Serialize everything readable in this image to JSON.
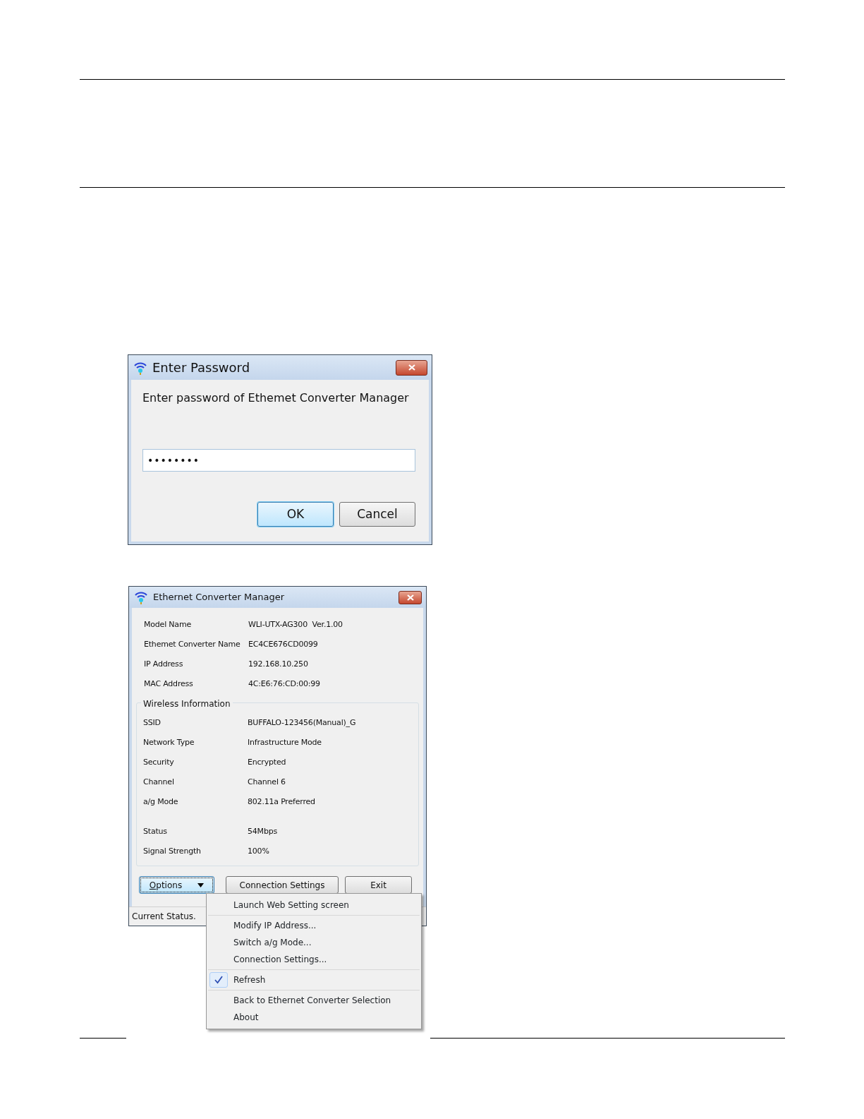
{
  "password_dialog": {
    "title": "Enter Password",
    "prompt": "Enter password of Ethemet Converter Manager",
    "password_field": {
      "value": "••••••••"
    },
    "buttons": [
      {
        "label": "OK",
        "default": true
      },
      {
        "label": "Cancel",
        "default": false
      }
    ]
  },
  "manager_window": {
    "title": "Ethernet Converter Manager",
    "info": [
      {
        "label": "Model Name",
        "value": "WLI-UTX-AG300  Ver.1.00"
      },
      {
        "label": "Ethemet Converter Name",
        "value": "EC4CE676CD0099"
      },
      {
        "label": "IP Address",
        "value": "192.168.10.250"
      },
      {
        "label": "MAC Address",
        "value": "4C:E6:76:CD:00:99"
      }
    ],
    "wireless_group": {
      "title": "Wireless Information",
      "rows": [
        {
          "label": "SSID",
          "value": "BUFFALO-123456(Manual)_G"
        },
        {
          "label": "Network Type",
          "value": "Infrastructure Mode"
        },
        {
          "label": "Security",
          "value": "Encrypted"
        },
        {
          "label": "Channel",
          "value": "Channel 6"
        },
        {
          "label": "a/g Mode",
          "value": "802.11a Preferred"
        }
      ],
      "status_rows": [
        {
          "label": "Status",
          "value": "54Mbps"
        },
        {
          "label": "Signal Strength",
          "value": "100%"
        }
      ]
    },
    "buttons": [
      {
        "label": "Options",
        "focused": true,
        "dropdown": true
      },
      {
        "label": "Connection Settings",
        "focused": false,
        "dropdown": false
      },
      {
        "label": "Exit",
        "focused": false,
        "dropdown": false
      }
    ],
    "status_bar": "Current Status."
  },
  "options_menu": {
    "groups": [
      [
        {
          "label": "Launch Web Setting screen",
          "checked": false
        }
      ],
      [
        {
          "label": "Modify IP Address...",
          "checked": false
        },
        {
          "label": "Switch a/g Mode...",
          "checked": false
        },
        {
          "label": "Connection Settings...",
          "checked": false
        }
      ],
      [
        {
          "label": "Refresh",
          "checked": true
        }
      ],
      [
        {
          "label": "Back to Ethernet Converter Selection",
          "checked": false
        },
        {
          "label": "About",
          "checked": false
        }
      ]
    ]
  }
}
